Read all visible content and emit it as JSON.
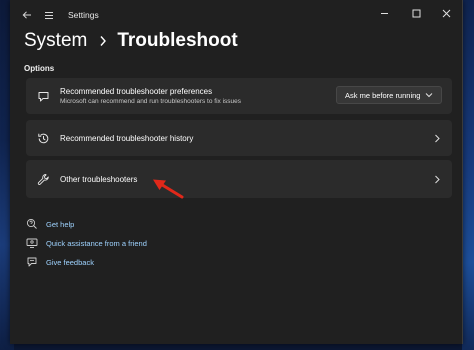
{
  "window": {
    "title": "Settings"
  },
  "breadcrumb": {
    "parent": "System",
    "current": "Troubleshoot"
  },
  "section": {
    "label": "Options"
  },
  "cards": {
    "preferences": {
      "title": "Recommended troubleshooter preferences",
      "subtitle": "Microsoft can recommend and run troubleshooters to fix issues",
      "dropdown_value": "Ask me before running"
    },
    "history": {
      "title": "Recommended troubleshooter history"
    },
    "other": {
      "title": "Other troubleshooters"
    }
  },
  "links": [
    {
      "label": "Get help",
      "icon": "help-icon"
    },
    {
      "label": "Quick assistance from a friend",
      "icon": "quick-assist-icon"
    },
    {
      "label": "Give feedback",
      "icon": "feedback-icon"
    }
  ],
  "colors": {
    "window_bg": "#202020",
    "card_bg": "#2b2b2b",
    "link": "#9fd3ff",
    "annotation_arrow": "#e0281a"
  }
}
